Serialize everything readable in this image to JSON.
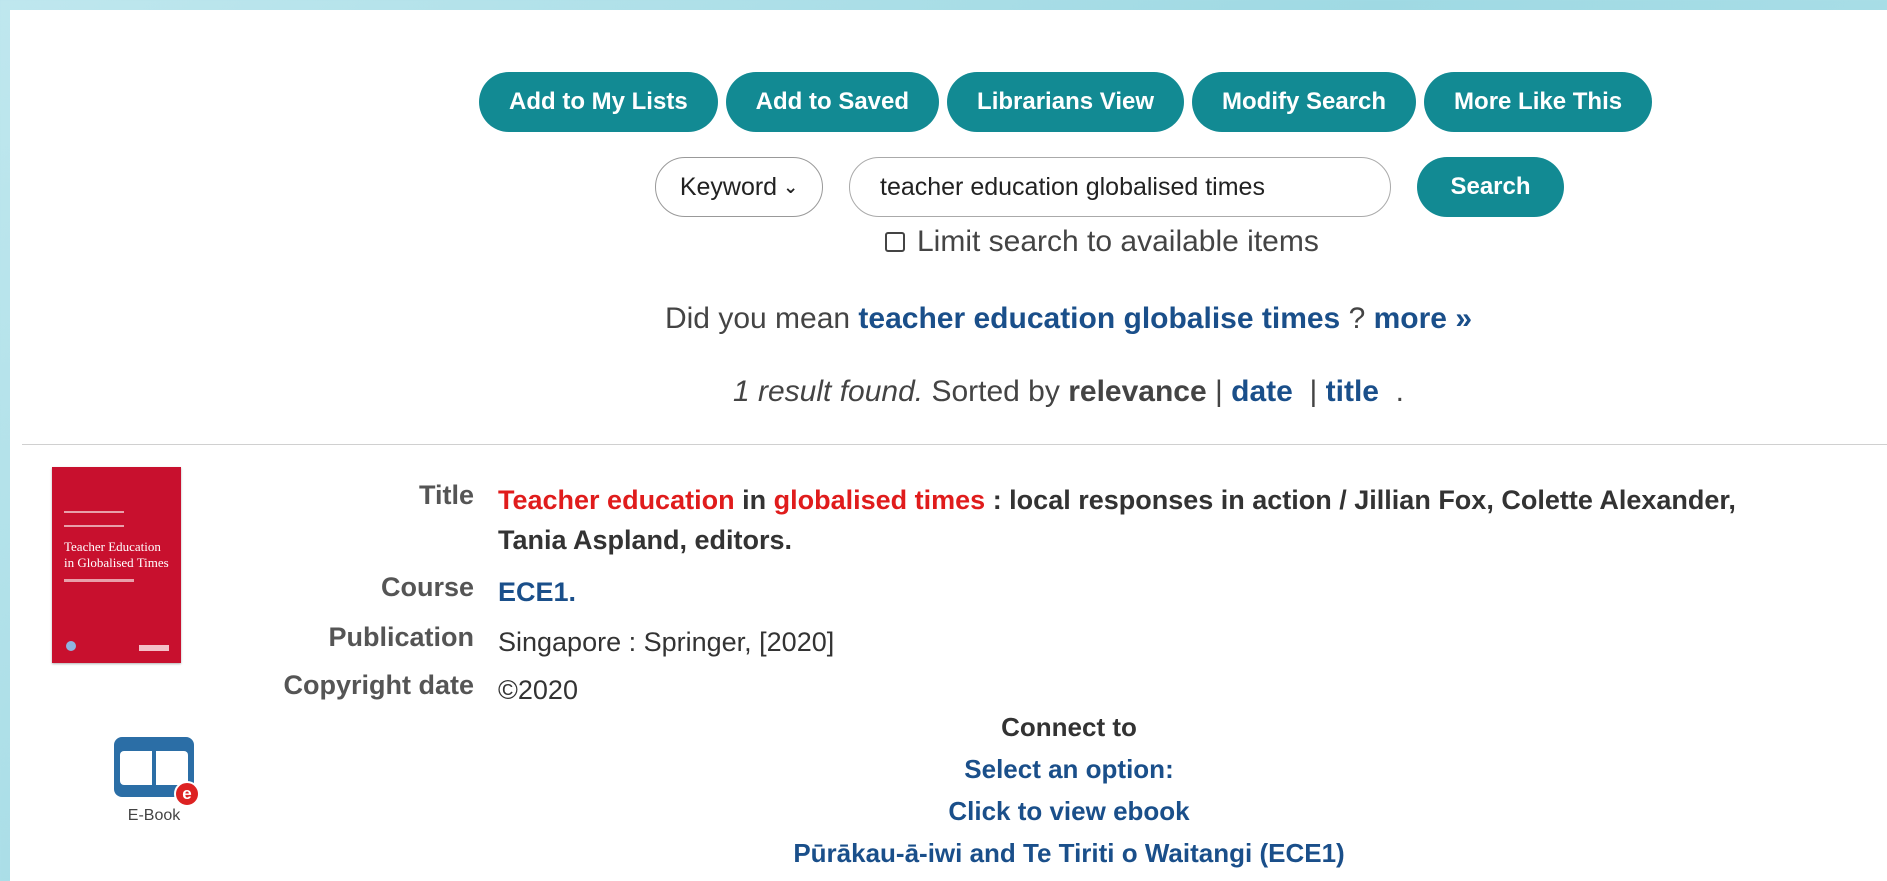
{
  "toolbar": {
    "buttons": [
      "Add to My Lists",
      "Add to Saved",
      "Librarians View",
      "Modify Search",
      "More Like This"
    ]
  },
  "search": {
    "type_selected": "Keyword",
    "query": "teacher education globalised times",
    "button_label": "Search",
    "limit_label": "Limit search to available items"
  },
  "suggestion": {
    "prefix": "Did you mean",
    "suggested_query": "teacher education globalise times",
    "suffix": "?",
    "more_label": "more »"
  },
  "results_summary": {
    "count_text": "1 result found.",
    "sorted_by": "Sorted by",
    "sort_current": "relevance",
    "sep1": "|",
    "sort_date": "date",
    "sep2": "|",
    "sort_title": "title",
    "end": "."
  },
  "record": {
    "cover": {
      "title_text": "Teacher Education in Globalised Times"
    },
    "format_label": "E-Book",
    "fields": {
      "title": {
        "label": "Title",
        "hl1": "Teacher education",
        "mid": "in",
        "hl2": "globalised times",
        "rest": ": local responses in action / Jillian Fox, Colette Alexander, Tania Aspland, editors."
      },
      "course": {
        "label": "Course",
        "value": "ECE1."
      },
      "publication": {
        "label": "Publication",
        "value": "Singapore : Springer, [2020]"
      },
      "copyright": {
        "label": "Copyright date",
        "value": "©2020"
      }
    },
    "connect": {
      "heading": "Connect to",
      "select_option": "Select an option:",
      "view_ebook": "Click to view ebook",
      "course_link": "Pūrākau-ā-iwi and Te Tiriti o Waitangi (ECE1)"
    }
  }
}
